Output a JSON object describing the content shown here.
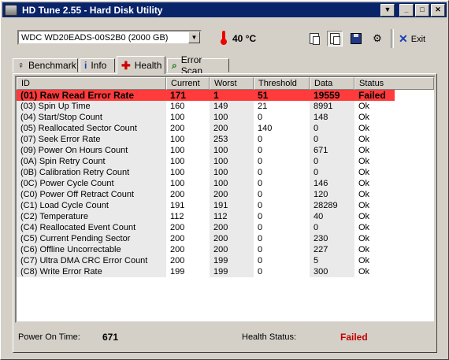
{
  "window": {
    "title": "HD Tune 2.55 - Hard Disk Utility"
  },
  "toolbar": {
    "drive": "WDC WD20EADS-00S2B0 (2000 GB)",
    "temperature": "40 °C",
    "exit_label": "Exit"
  },
  "tabs": [
    {
      "label": "Benchmark",
      "icon": "benchmark-icon"
    },
    {
      "label": "Info",
      "icon": "info-icon"
    },
    {
      "label": "Health",
      "icon": "health-icon",
      "active": true
    },
    {
      "label": "Error Scan",
      "icon": "search-icon"
    }
  ],
  "table": {
    "columns": [
      "ID",
      "Current",
      "Worst",
      "Threshold",
      "Data",
      "Status"
    ],
    "rows": [
      {
        "id": "(01) Raw Read Error Rate",
        "current": "171",
        "worst": "1",
        "threshold": "51",
        "data": "19559",
        "status": "Failed"
      },
      {
        "id": "(03) Spin Up Time",
        "current": "160",
        "worst": "149",
        "threshold": "21",
        "data": "8991",
        "status": "Ok"
      },
      {
        "id": "(04) Start/Stop Count",
        "current": "100",
        "worst": "100",
        "threshold": "0",
        "data": "148",
        "status": "Ok"
      },
      {
        "id": "(05) Reallocated Sector Count",
        "current": "200",
        "worst": "200",
        "threshold": "140",
        "data": "0",
        "status": "Ok"
      },
      {
        "id": "(07) Seek Error Rate",
        "current": "100",
        "worst": "253",
        "threshold": "0",
        "data": "0",
        "status": "Ok"
      },
      {
        "id": "(09) Power On Hours Count",
        "current": "100",
        "worst": "100",
        "threshold": "0",
        "data": "671",
        "status": "Ok"
      },
      {
        "id": "(0A) Spin Retry Count",
        "current": "100",
        "worst": "100",
        "threshold": "0",
        "data": "0",
        "status": "Ok"
      },
      {
        "id": "(0B) Calibration Retry Count",
        "current": "100",
        "worst": "100",
        "threshold": "0",
        "data": "0",
        "status": "Ok"
      },
      {
        "id": "(0C) Power Cycle Count",
        "current": "100",
        "worst": "100",
        "threshold": "0",
        "data": "146",
        "status": "Ok"
      },
      {
        "id": "(C0) Power Off Retract Count",
        "current": "200",
        "worst": "200",
        "threshold": "0",
        "data": "120",
        "status": "Ok"
      },
      {
        "id": "(C1) Load Cycle Count",
        "current": "191",
        "worst": "191",
        "threshold": "0",
        "data": "28289",
        "status": "Ok"
      },
      {
        "id": "(C2) Temperature",
        "current": "112",
        "worst": "112",
        "threshold": "0",
        "data": "40",
        "status": "Ok"
      },
      {
        "id": "(C4) Reallocated Event Count",
        "current": "200",
        "worst": "200",
        "threshold": "0",
        "data": "0",
        "status": "Ok"
      },
      {
        "id": "(C5) Current Pending Sector",
        "current": "200",
        "worst": "200",
        "threshold": "0",
        "data": "230",
        "status": "Ok"
      },
      {
        "id": "(C6) Offline Uncorrectable",
        "current": "200",
        "worst": "200",
        "threshold": "0",
        "data": "227",
        "status": "Ok"
      },
      {
        "id": "(C7) Ultra DMA CRC Error Count",
        "current": "200",
        "worst": "199",
        "threshold": "0",
        "data": "5",
        "status": "Ok"
      },
      {
        "id": "(C8) Write Error Rate",
        "current": "199",
        "worst": "199",
        "threshold": "0",
        "data": "300",
        "status": "Ok"
      }
    ]
  },
  "footer": {
    "power_on_label": "Power On Time:",
    "power_on_value": "671",
    "health_label": "Health Status:",
    "health_value": "Failed"
  },
  "colors": {
    "title_bar": "#0a246a",
    "failed_row": "#ff3b3b",
    "failed_text": "#c00000"
  }
}
